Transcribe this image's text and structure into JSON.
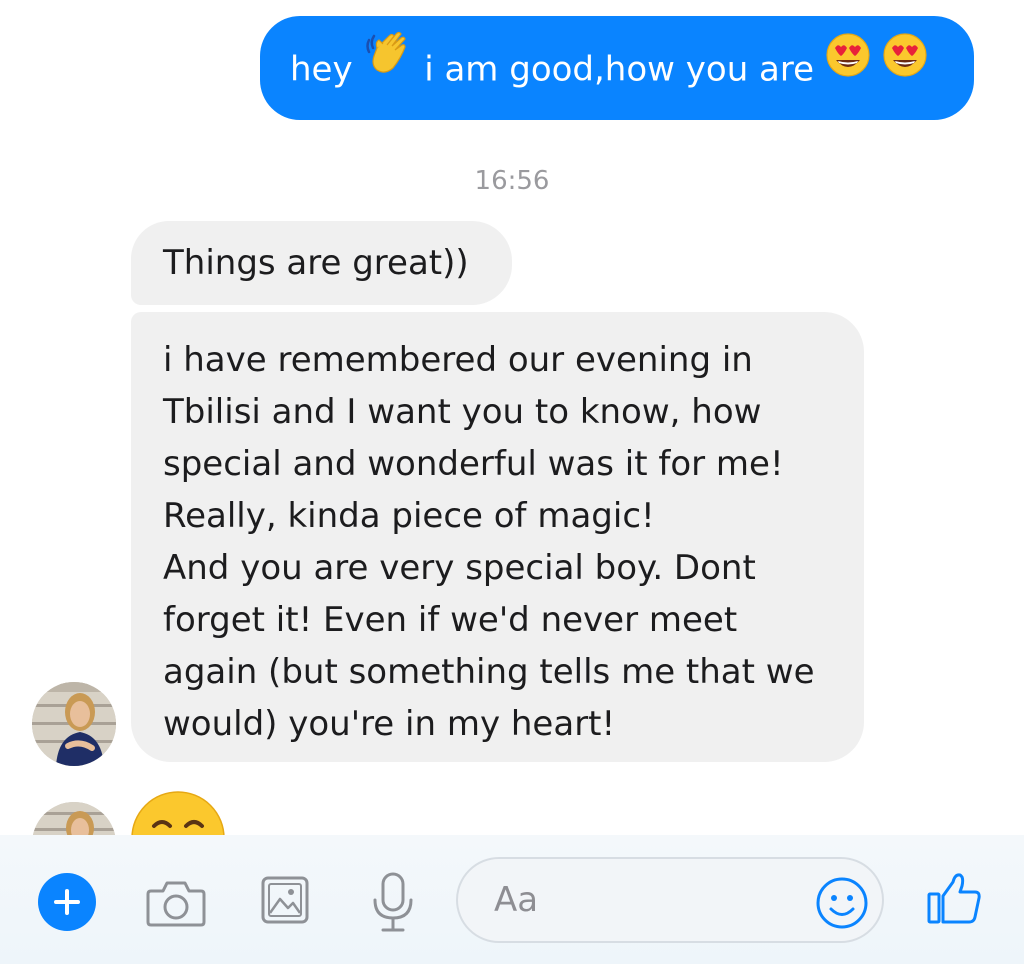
{
  "thread": {
    "outgoing_message": {
      "part1": "hey",
      "part2": "i am good,how you are",
      "emojis": [
        "waving-hand-emoji",
        "heart-eyes-emoji",
        "heart-eyes-emoji"
      ]
    },
    "timestamp": "16:56",
    "incoming_messages": [
      {
        "lines": [
          "Things are great))"
        ]
      },
      {
        "lines": [
          "i have remembered our evening in",
          "Tbilisi and I want you to know, how",
          "special and wonderful was it for me!",
          "Really, kinda piece of magic!",
          "And you are very special boy. Dont",
          "forget it! Even if we'd never meet",
          "again (but something tells me that we",
          "would) you're in my heart!"
        ]
      },
      {
        "emoji": "smiling-blush-emoji"
      }
    ]
  },
  "composer": {
    "placeholder": "Aa",
    "icons": [
      "plus-icon",
      "camera-icon",
      "photo-icon",
      "microphone-icon",
      "smiley-icon",
      "thumbs-up-icon"
    ]
  },
  "colors": {
    "accent": "#0a84ff",
    "incoming_bubble": "#f0f0f0",
    "timestamp": "#9a9a9e"
  }
}
